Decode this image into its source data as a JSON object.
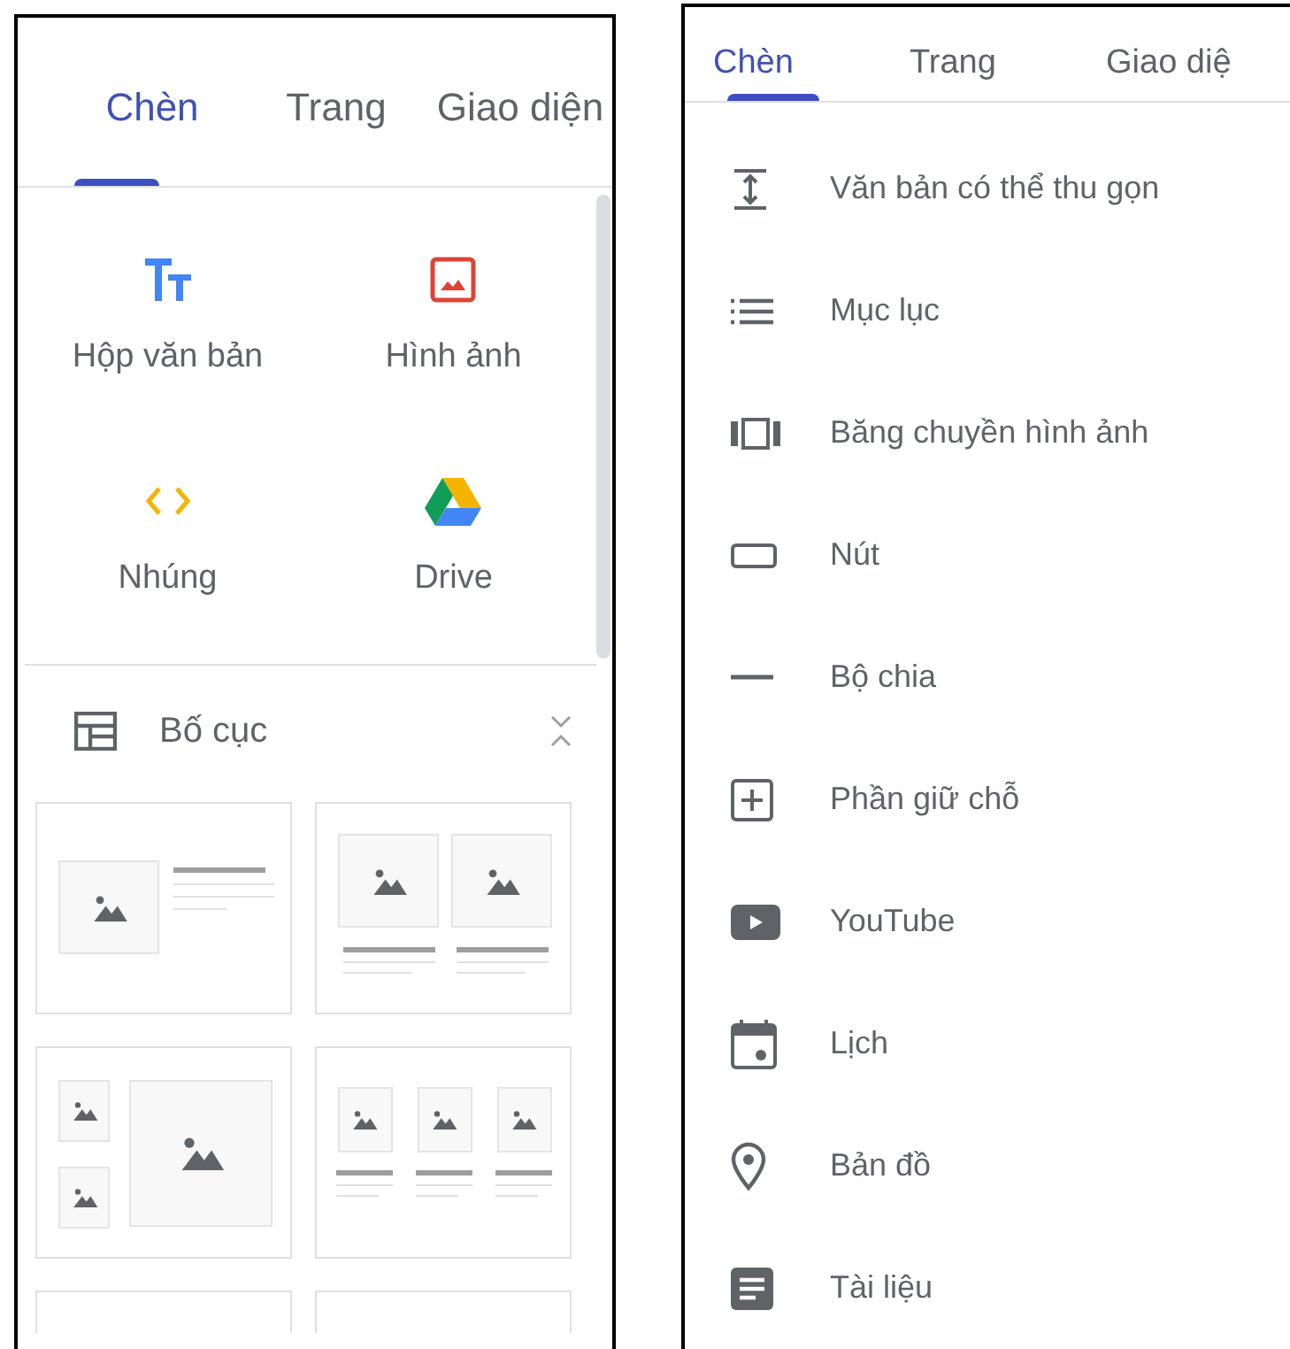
{
  "left_panel": {
    "tabs": [
      {
        "label": "Chèn",
        "selected": true
      },
      {
        "label": "Trang",
        "selected": false
      },
      {
        "label": "Giao diện",
        "selected": false
      }
    ],
    "tiles": [
      {
        "kind": "text",
        "label": "Hộp văn bản"
      },
      {
        "kind": "image",
        "label": "Hình ảnh"
      },
      {
        "kind": "embed",
        "label": "Nhúng"
      },
      {
        "kind": "drive",
        "label": "Drive"
      }
    ],
    "section": {
      "title": "Bố cục",
      "expanded": true
    },
    "layouts": [
      {
        "kind": "image-text"
      },
      {
        "kind": "two-column"
      },
      {
        "kind": "three-images"
      },
      {
        "kind": "three-column"
      },
      {
        "kind": "partial"
      },
      {
        "kind": "partial"
      }
    ]
  },
  "right_panel": {
    "tabs": [
      {
        "label": "Chèn",
        "selected": true
      },
      {
        "label": "Trang",
        "selected": false
      },
      {
        "label": "Giao diệ",
        "selected": false
      }
    ],
    "items": [
      {
        "kind": "collapsible",
        "label": "Văn bản có thể thu gọn"
      },
      {
        "kind": "toc",
        "label": "Mục lục"
      },
      {
        "kind": "carousel",
        "label": "Băng chuyền hình ảnh"
      },
      {
        "kind": "button",
        "label": "Nút"
      },
      {
        "kind": "divider",
        "label": "Bộ chia"
      },
      {
        "kind": "placeholder",
        "label": "Phần giữ chỗ"
      },
      {
        "kind": "youtube",
        "label": "YouTube"
      },
      {
        "kind": "calendar",
        "label": "Lịch"
      },
      {
        "kind": "map",
        "label": "Bản đồ"
      },
      {
        "kind": "docs",
        "label": "Tài liệu"
      }
    ]
  }
}
